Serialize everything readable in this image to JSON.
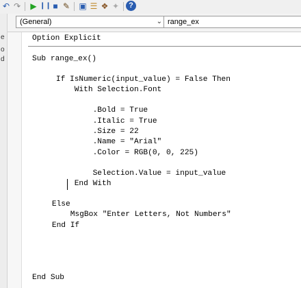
{
  "toolbar": {
    "icons": [
      "undo-icon",
      "redo-icon",
      "run-icon",
      "pause-icon",
      "stop-icon",
      "design-mode-icon",
      "project-explorer-icon",
      "properties-icon",
      "object-browser-icon",
      "toolbox-icon",
      "help-icon"
    ]
  },
  "left_strip": {
    "glyphs": [
      "e",
      "o",
      "d"
    ]
  },
  "object_dropdown": {
    "value": "(General)"
  },
  "procedure_dropdown": {
    "value": "range_ex"
  },
  "code": {
    "lines": [
      "Option Explicit",
      "Sub range_ex()",
      "    If IsNumeric(input_value) = False Then",
      "        With Selection.Font",
      "            .Bold = True",
      "            .Italic = True",
      "            .Size = 22",
      "            .Name = \"Arial\"",
      "            .Color = RGB(0, 0, 225)",
      "            Selection.Value = input_value",
      "        End With",
      "    Else",
      "        MsgBox \"Enter Letters, Not Numbers\"",
      "    End If",
      "End Sub"
    ]
  },
  "colors": {
    "code_text": "#000000",
    "help_blue": "#2a5db0",
    "run_green": "#23a323"
  }
}
